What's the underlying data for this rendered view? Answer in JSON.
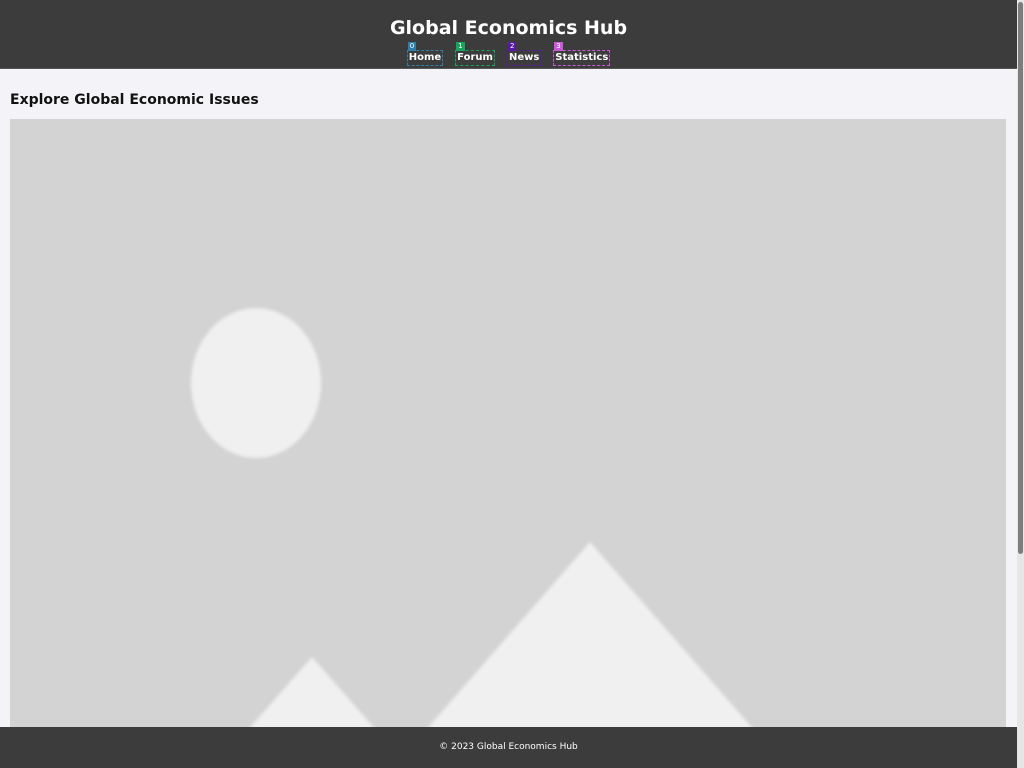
{
  "site": {
    "title": "Global Economics Hub"
  },
  "nav": {
    "items": [
      {
        "label": "Home",
        "badge": "0",
        "color": "#2f7fa8",
        "name": "nav-home"
      },
      {
        "label": "Forum",
        "badge": "1",
        "color": "#1aa35b",
        "name": "nav-forum"
      },
      {
        "label": "News",
        "badge": "2",
        "color": "#5b1aa3",
        "name": "nav-news"
      },
      {
        "label": "Statistics",
        "badge": "3",
        "color": "#c95cd6",
        "name": "nav-statistics"
      }
    ]
  },
  "main": {
    "heading": "Explore Global Economic Issues",
    "image_icon": "image-placeholder-icon"
  },
  "footer": {
    "text": "© 2023 Global Economics Hub"
  },
  "colors": {
    "header_bg": "#3c3c3c",
    "page_bg": "#f4f4f8",
    "placeholder_bg": "#d3d3d3",
    "placeholder_shape": "#f0f0f0"
  }
}
